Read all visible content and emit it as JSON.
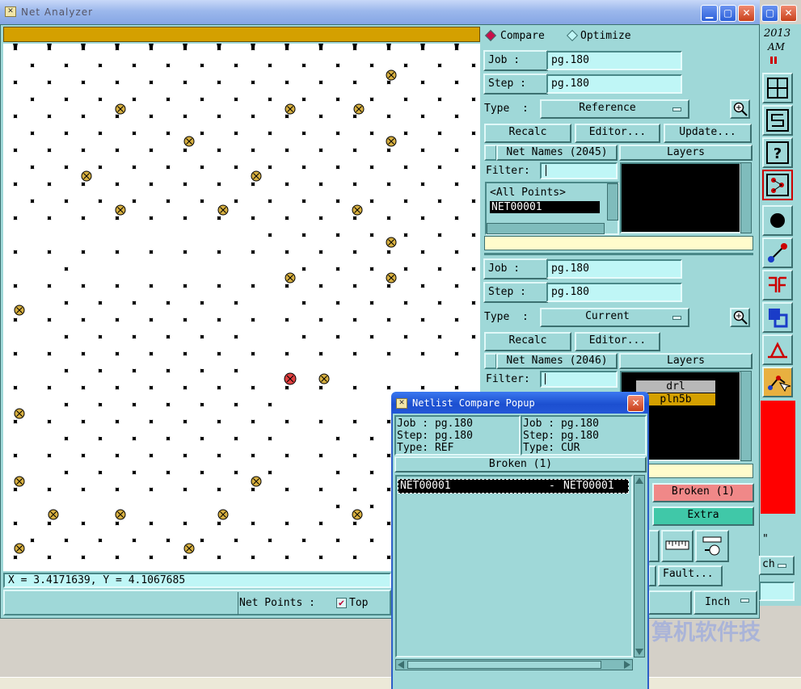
{
  "main_window": {
    "title": "Net Analyzer",
    "coords_readout": "X = 3.4171639, Y = 4.1067685",
    "net_points_label": "Net Points :",
    "net_points_top_label": "Top",
    "net_points_top_checked": true
  },
  "top_right_year": "2013",
  "top_right_ampm": "AM",
  "mode": {
    "compare_label": "Compare",
    "optimize_label": "Optimize",
    "selected": "compare"
  },
  "reference": {
    "job_label": "Job   :",
    "job_value": "pg.180",
    "step_label": "Step  :",
    "step_value": "pg.180",
    "type_label": "Type  :",
    "type_value": "Reference",
    "recalc_label": "Recalc",
    "editor_label": "Editor...",
    "update_label": "Update...",
    "net_names_header": "Net Names (2045)",
    "layers_header": "Layers",
    "filter_label": "Filter:",
    "filter_value": "",
    "net_list": [
      "<All Points>",
      "NET00001"
    ],
    "selected_net_index": 1,
    "layers": []
  },
  "current": {
    "job_label": "Job   :",
    "job_value": "pg.180",
    "step_label": "Step  :",
    "step_value": "pg.180",
    "type_label": "Type  :",
    "type_value": "Current",
    "recalc_label": "Recalc",
    "editor_label": "Editor...",
    "net_names_header": "Net Names (2046)",
    "layers_header": "Layers",
    "filter_label": "Filter:",
    "filter_value": "",
    "layers": [
      {
        "name": "drl",
        "color": "#b8b8b8"
      },
      {
        "name": "pln5b",
        "color": "#d4a000"
      }
    ]
  },
  "results": {
    "broken_label": "Broken (1)",
    "broken_color": "#f08888",
    "extra_label": "Extra",
    "fault_label": "Fault...",
    "units_value": "Inch",
    "side_dropdown_fragment": "ch",
    "side_quote_fragment": "\""
  },
  "popup": {
    "title": "Netlist Compare Popup",
    "ref_job": "Job : pg.180",
    "ref_step": "Step: pg.180",
    "ref_type": "Type: REF",
    "cur_job": "Job : pg.180",
    "cur_step": "Step: pg.180",
    "cur_type": "Type: CUR",
    "list_header": "Broken (1)",
    "rows": [
      {
        "left": "NET00001",
        "sep": "-",
        "right": "NET00001"
      }
    ]
  },
  "background_text": "算机软件技",
  "colors": {
    "panel": "#9fd8d8",
    "field": "#bff6f6",
    "gold_bar": "#d4a000",
    "pale_strip": "#fffccc",
    "alert_red": "#ff0000"
  }
}
